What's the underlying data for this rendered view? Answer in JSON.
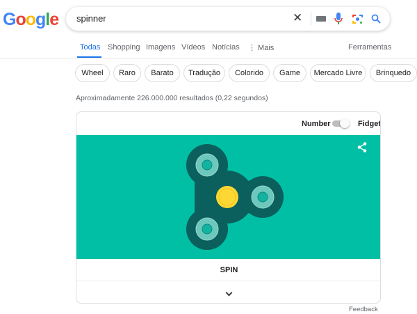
{
  "logo": {
    "letters": [
      "G",
      "o",
      "o",
      "g",
      "l",
      "e"
    ],
    "colors": [
      "#4285f4",
      "#ea4335",
      "#fbbc05",
      "#4285f4",
      "#34a853",
      "#ea4335"
    ]
  },
  "search": {
    "query": "spinner",
    "clear_icon": "close-icon",
    "keyboard_icon": "keyboard-icon",
    "mic_icon": "mic-icon",
    "lens_icon": "lens-icon",
    "search_icon": "search-icon"
  },
  "tabs": [
    {
      "label": "Todas"
    },
    {
      "label": "Shopping"
    },
    {
      "label": "Imagens"
    },
    {
      "label": "Vídeos"
    },
    {
      "label": "Notícias"
    },
    {
      "label": "⋮ Mais"
    }
  ],
  "tools": "Ferramentas",
  "chips": [
    "Wheel",
    "Raro",
    "Barato",
    "Tradução",
    "Colorido",
    "Game",
    "Mercado Livre",
    "Brinquedo"
  ],
  "stats": "Aproximadamente 226.000.000 resultados (0,22 segundos)",
  "widget": {
    "mode_left": "Number",
    "mode_right": "Fidget",
    "mode_selected": "Fidget",
    "spin": "SPIN",
    "colors": {
      "bg": "#00bfa5",
      "body": "#0b5f5c",
      "ring": "#6cc7bd",
      "hub": "#fdd835"
    }
  },
  "feedback": "Feedback"
}
